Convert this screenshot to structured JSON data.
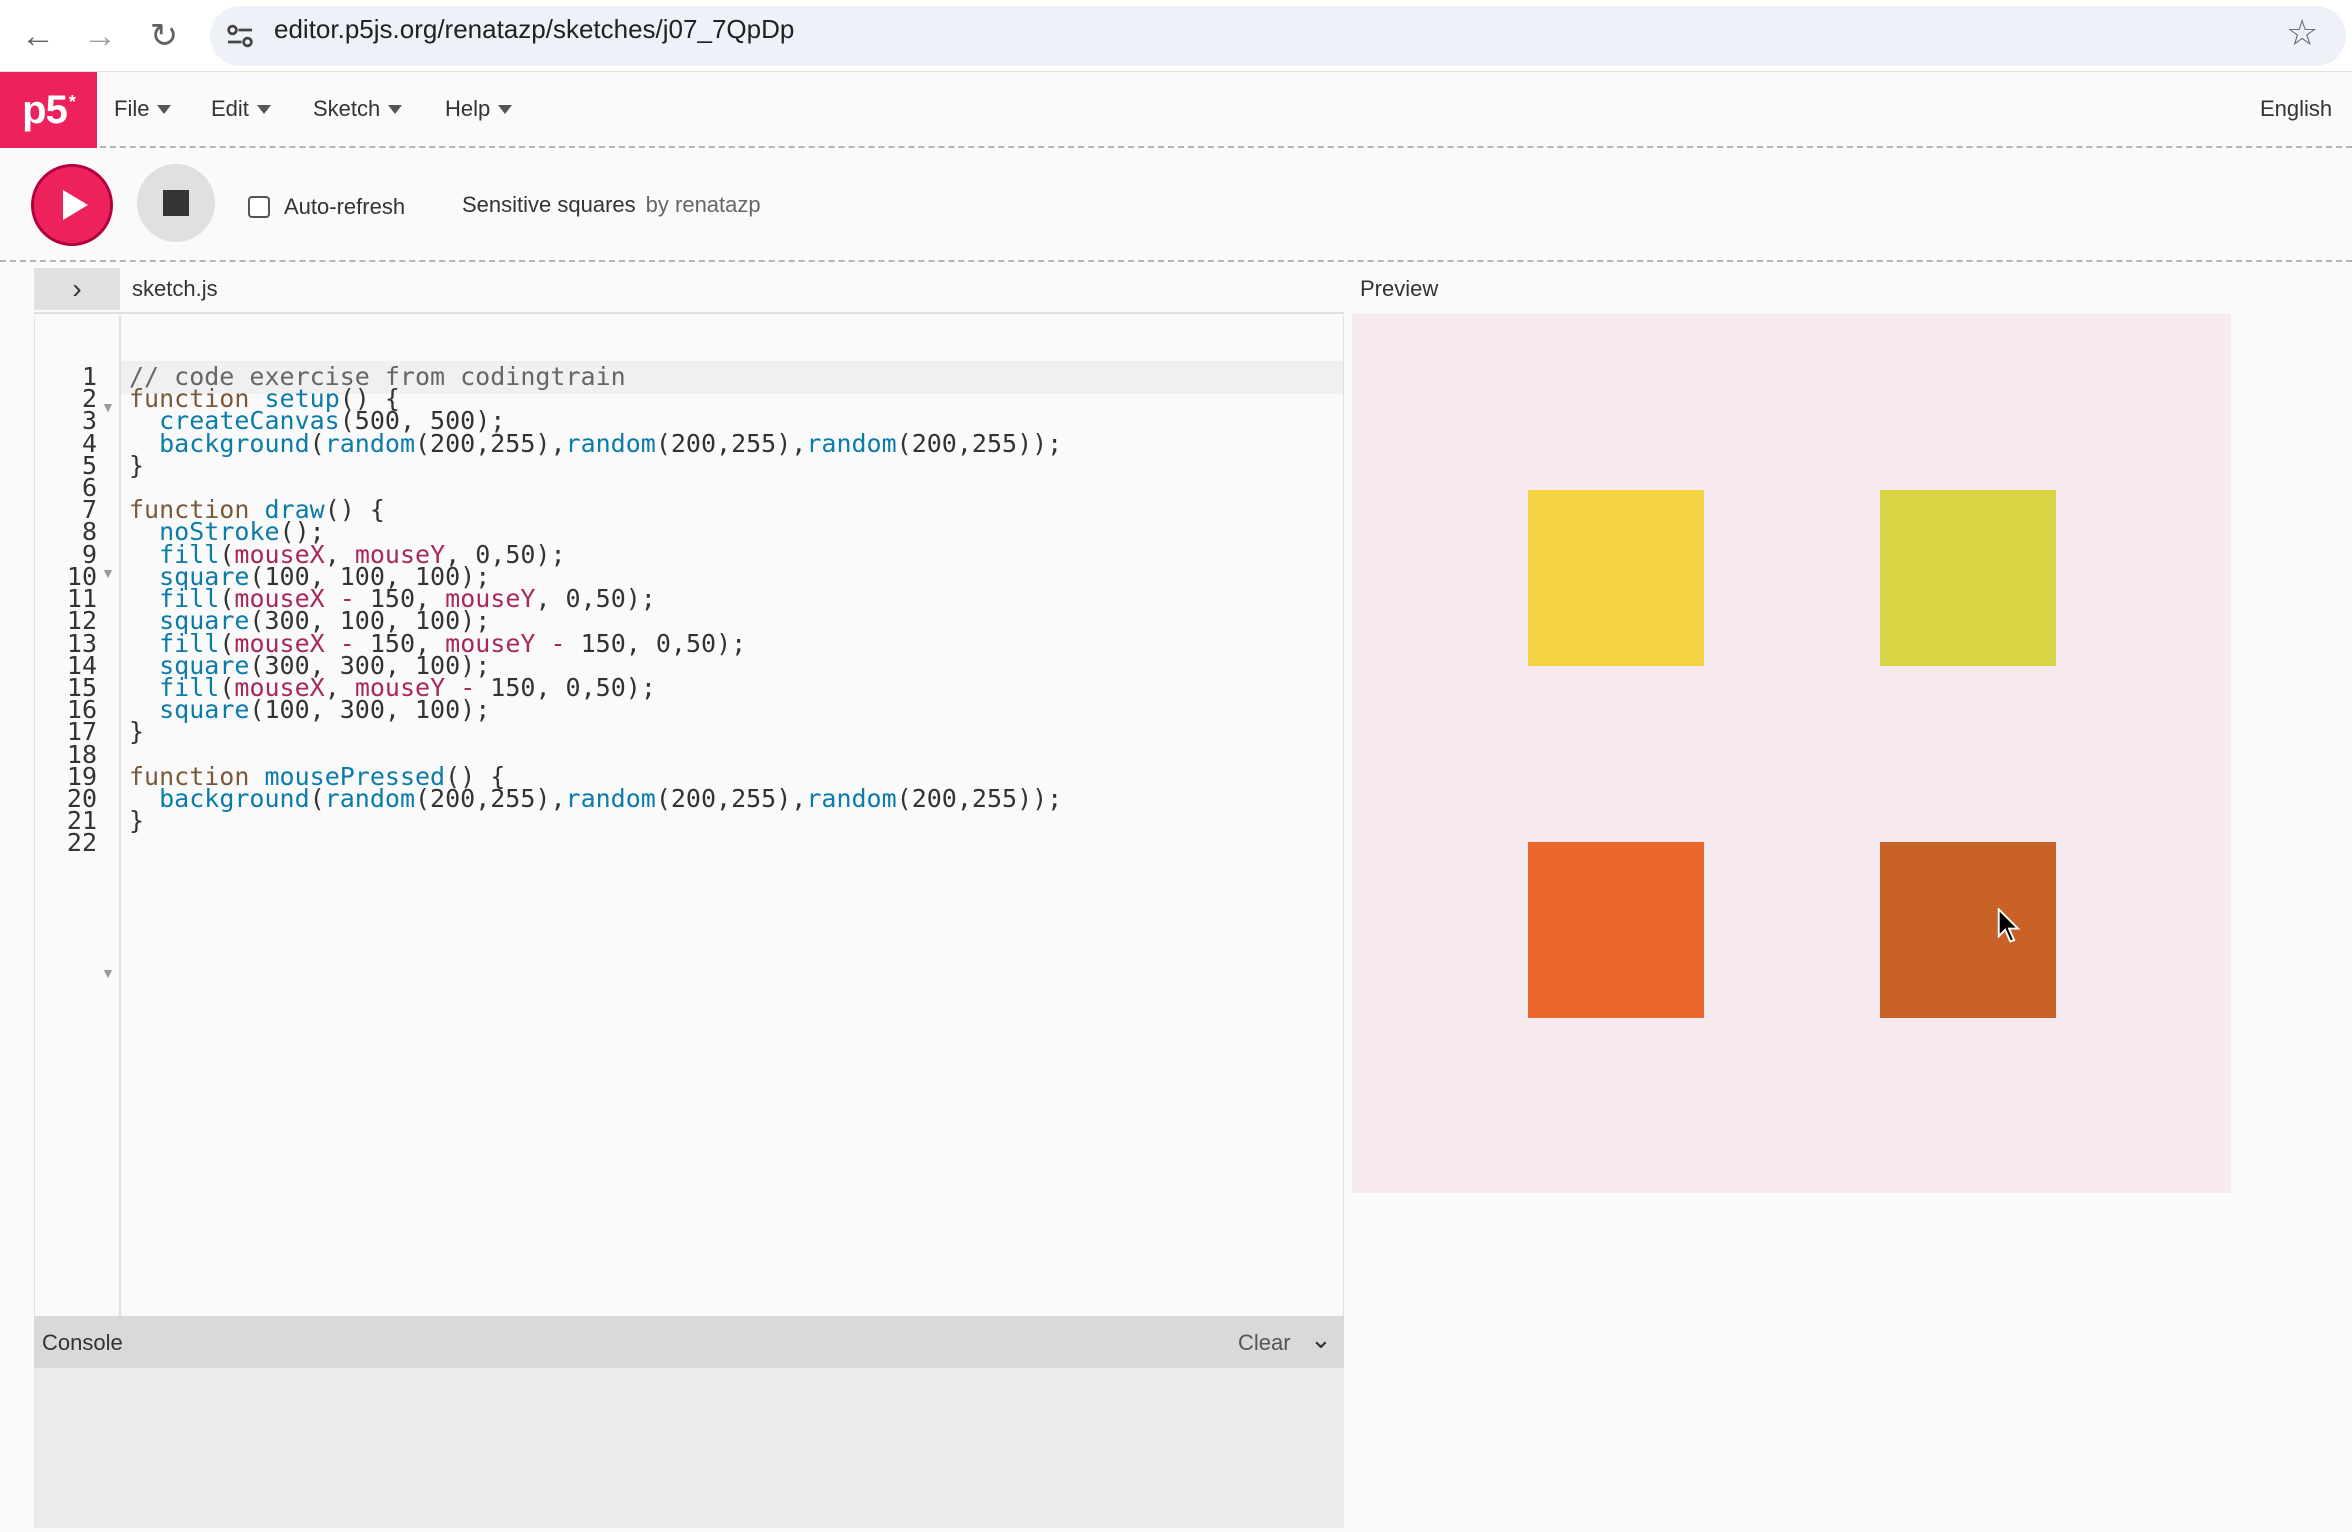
{
  "browser": {
    "url": "editor.p5js.org/renatazp/sketches/j07_7QpDp",
    "back_icon": "←",
    "forward_icon": "→",
    "reload_icon": "↻",
    "star_icon": "☆"
  },
  "nav": {
    "logo": "p5",
    "logo_sup": "*",
    "menus": [
      "File",
      "Edit",
      "Sketch",
      "Help"
    ],
    "language": "English"
  },
  "toolbar": {
    "auto_refresh_label": "Auto-refresh",
    "sketch_name": "Sensitive squares",
    "by_label": "by renatazp"
  },
  "editor": {
    "file_name": "sketch.js",
    "toggle_icon": "›",
    "lines": [
      "1",
      "2",
      "3",
      "4",
      "5",
      "6",
      "7",
      "8",
      "9",
      "10",
      "11",
      "12",
      "13",
      "14",
      "15",
      "16",
      "17",
      "18",
      "19",
      "20",
      "21",
      "22"
    ]
  },
  "console": {
    "title": "Console",
    "clear_label": "Clear",
    "chevron_icon": "⌄"
  },
  "preview": {
    "label": "Preview",
    "background": "#f6eaee",
    "squares": [
      {
        "name": "top-left",
        "color": "#f5d342"
      },
      {
        "name": "top-right",
        "color": "#d9d443"
      },
      {
        "name": "bottom-left",
        "color": "#ea672c"
      },
      {
        "name": "bottom-right",
        "color": "#c96226"
      }
    ]
  },
  "colors": {
    "accent": "#ed225d",
    "keyword": "#7a5a3a",
    "function": "#0b7ca9",
    "variable": "#a7285e"
  }
}
